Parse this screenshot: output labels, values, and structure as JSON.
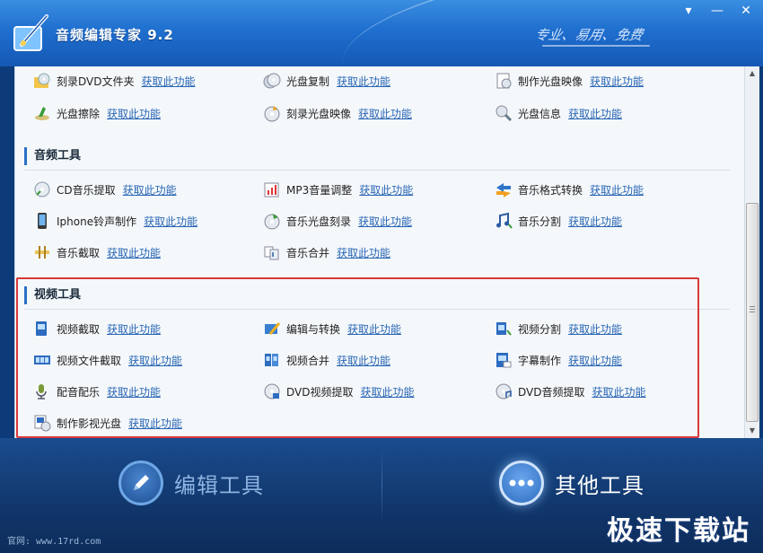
{
  "window": {
    "title": "音频编辑专家 9.2",
    "slogan": "专业、易用、免费",
    "buttons": {
      "menu": "▾",
      "minimize": "—",
      "close": "✕"
    }
  },
  "link_text": "获取此功能",
  "sections": [
    {
      "title": "",
      "rows": [
        [
          {
            "name": "刻录DVD文件夹",
            "icon": "dvd-folder-icon"
          },
          {
            "name": "光盘复制",
            "icon": "disc-copy-icon"
          },
          {
            "name": "制作光盘映像",
            "icon": "disc-image-icon"
          }
        ],
        [
          {
            "name": "光盘擦除",
            "icon": "disc-erase-icon"
          },
          {
            "name": "刻录光盘映像",
            "icon": "burn-image-icon"
          },
          {
            "name": "光盘信息",
            "icon": "disc-info-icon"
          }
        ]
      ]
    },
    {
      "title": "音频工具",
      "rows": [
        [
          {
            "name": "CD音乐提取",
            "icon": "cd-rip-icon"
          },
          {
            "name": "MP3音量调整",
            "icon": "volume-icon"
          },
          {
            "name": "音乐格式转换",
            "icon": "format-convert-icon"
          }
        ],
        [
          {
            "name": "Iphone铃声制作",
            "icon": "phone-ringtone-icon"
          },
          {
            "name": "音乐光盘刻录",
            "icon": "music-burn-icon"
          },
          {
            "name": "音乐分割",
            "icon": "music-split-icon"
          }
        ],
        [
          {
            "name": "音乐截取",
            "icon": "music-cut-icon"
          },
          {
            "name": "音乐合并",
            "icon": "music-merge-icon"
          }
        ]
      ]
    },
    {
      "title": "视频工具",
      "rows": [
        [
          {
            "name": "视频截取",
            "icon": "video-cut-icon"
          },
          {
            "name": "编辑与转换",
            "icon": "video-edit-icon"
          },
          {
            "name": "视频分割",
            "icon": "video-split-icon"
          }
        ],
        [
          {
            "name": "视频文件截取",
            "icon": "film-strip-icon"
          },
          {
            "name": "视频合并",
            "icon": "video-merge-icon"
          },
          {
            "name": "字幕制作",
            "icon": "subtitle-icon"
          }
        ],
        [
          {
            "name": "配音配乐",
            "icon": "dubbing-icon"
          },
          {
            "name": "DVD视频提取",
            "icon": "dvd-video-icon"
          },
          {
            "name": "DVD音频提取",
            "icon": "dvd-audio-icon"
          }
        ],
        [
          {
            "name": "制作影视光盘",
            "icon": "movie-disc-icon"
          }
        ]
      ]
    }
  ],
  "nav": {
    "edit_tools": "编辑工具",
    "other_tools": "其他工具"
  },
  "footer": {
    "site": "官网: www.17rd.com",
    "watermark": "极速下载站"
  },
  "colors": {
    "accent": "#2b6fc6",
    "link": "#2a66b4",
    "highlight": "#d9383a"
  }
}
